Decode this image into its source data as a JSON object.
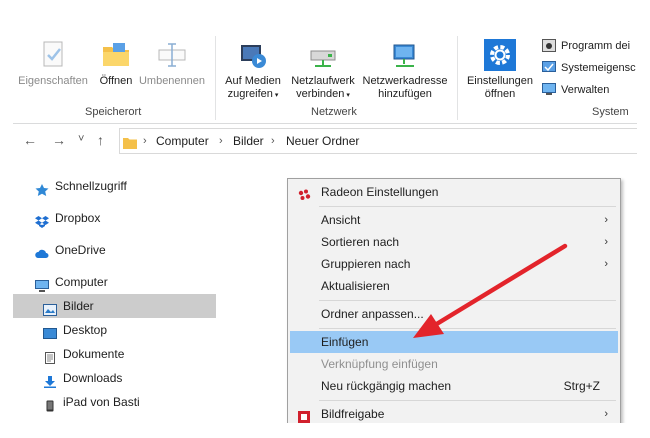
{
  "ribbon": {
    "groups": [
      {
        "label": "Speicherort",
        "buttons": [
          {
            "label": "Eigenschaften",
            "icon": "properties-icon",
            "enabled": false
          },
          {
            "label": "Öffnen",
            "icon": "open-folder-icon",
            "enabled": true
          },
          {
            "label": "Umbenennen",
            "icon": "rename-icon",
            "enabled": false
          }
        ]
      },
      {
        "label": "Netzwerk",
        "buttons": [
          {
            "label_line1": "Auf Medien",
            "label_line2": "zugreifen",
            "icon": "media-icon"
          },
          {
            "label_line1": "Netzlaufwerk",
            "label_line2": "verbinden",
            "icon": "network-drive-icon"
          },
          {
            "label_line1": "Netzwerkadresse",
            "label_line2": "hinzufügen",
            "icon": "network-location-icon"
          }
        ]
      },
      {
        "label": "System",
        "buttons": [
          {
            "label_line1": "Einstellungen",
            "label_line2": "öffnen",
            "icon": "settings-gear-icon"
          }
        ],
        "small_items": [
          {
            "label": "Programm dei",
            "icon": "program-icon"
          },
          {
            "label": "Systemeigensc",
            "icon": "system-properties-icon"
          },
          {
            "label": "Verwalten",
            "icon": "manage-icon"
          }
        ]
      }
    ]
  },
  "address": {
    "back": "←",
    "forward": "→",
    "recent": "˅",
    "up": "↑",
    "crumbs": [
      "Computer",
      "Bilder",
      "Neuer Ordner"
    ],
    "separator": "›"
  },
  "nav": {
    "items": [
      {
        "label": "Schnellzugriff",
        "icon": "quick-access-star-icon",
        "selected": false
      },
      {
        "label": "Dropbox",
        "icon": "dropbox-icon",
        "selected": false
      },
      {
        "label": "OneDrive",
        "icon": "onedrive-cloud-icon",
        "selected": false
      },
      {
        "label": "Computer",
        "icon": "computer-icon",
        "selected": false
      },
      {
        "label": "Bilder",
        "icon": "pictures-icon",
        "selected": true
      },
      {
        "label": "Desktop",
        "icon": "desktop-icon",
        "selected": false
      },
      {
        "label": "Dokumente",
        "icon": "documents-icon",
        "selected": false
      },
      {
        "label": "Downloads",
        "icon": "downloads-icon",
        "selected": false
      },
      {
        "label": "iPad von Basti",
        "icon": "ipad-icon",
        "selected": false
      }
    ]
  },
  "context_menu": {
    "items": [
      {
        "label": "Radeon Einstellungen",
        "icon": "radeon-icon",
        "submenu": false,
        "shortcut": "",
        "state": "normal"
      },
      {
        "label": "Ansicht",
        "submenu": true,
        "shortcut": "",
        "state": "normal"
      },
      {
        "label": "Sortieren nach",
        "submenu": true,
        "shortcut": "",
        "state": "normal"
      },
      {
        "label": "Gruppieren nach",
        "submenu": true,
        "shortcut": "",
        "state": "normal"
      },
      {
        "label": "Aktualisieren",
        "submenu": false,
        "shortcut": "",
        "state": "normal"
      },
      {
        "label": "Ordner anpassen...",
        "submenu": false,
        "shortcut": "",
        "state": "normal"
      },
      {
        "label": "Einfügen",
        "submenu": false,
        "shortcut": "",
        "state": "highlighted"
      },
      {
        "label": "Verknüpfung einfügen",
        "submenu": false,
        "shortcut": "",
        "state": "disabled"
      },
      {
        "label": "Neu rückgängig machen",
        "submenu": false,
        "shortcut": "Strg+Z",
        "state": "normal"
      },
      {
        "label": "Bildfreigabe",
        "icon": "share-icon",
        "submenu": true,
        "shortcut": "",
        "state": "normal"
      }
    ],
    "submenu_glyph": "›"
  },
  "annotation": {
    "arrow_color": "#e3242b"
  },
  "colors": {
    "highlight": "#99c9f5",
    "selected_nav": "#cccccc",
    "menu_bg": "#f2f2f2",
    "accent_blue": "#1e78d7"
  }
}
